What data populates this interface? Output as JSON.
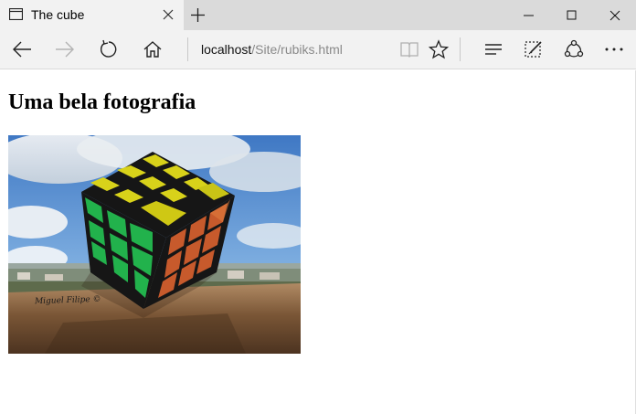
{
  "browser": {
    "tab": {
      "title": "The cube"
    },
    "address": {
      "host": "localhost",
      "path": "/Site/rubiks.html"
    }
  },
  "page": {
    "heading": "Uma bela fotografia",
    "image": {
      "alt": "Rubik's cube photo",
      "signature": "Miguel Filipe ©"
    }
  }
}
